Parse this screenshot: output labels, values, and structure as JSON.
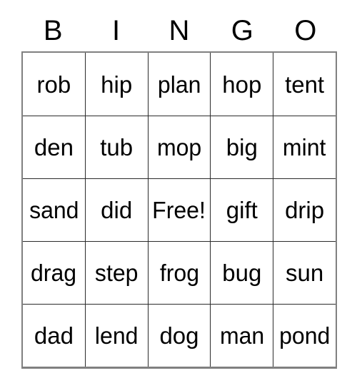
{
  "card": {
    "header_letters": [
      "B",
      "I",
      "N",
      "G",
      "O"
    ],
    "rows": [
      [
        "rob",
        "hip",
        "plan",
        "hop",
        "tent"
      ],
      [
        "den",
        "tub",
        "mop",
        "big",
        "mint"
      ],
      [
        "sand",
        "did",
        "Free!",
        "gift",
        "drip"
      ],
      [
        "drag",
        "step",
        "frog",
        "bug",
        "sun"
      ],
      [
        "dad",
        "lend",
        "dog",
        "man",
        "pond"
      ]
    ],
    "free_space": {
      "label": "Free!",
      "row": 2,
      "column": 2
    },
    "colors": {
      "background": "#ffffff",
      "text": "#000000",
      "grid_line": "#2b2b2b",
      "outer_border": "#808080"
    }
  }
}
